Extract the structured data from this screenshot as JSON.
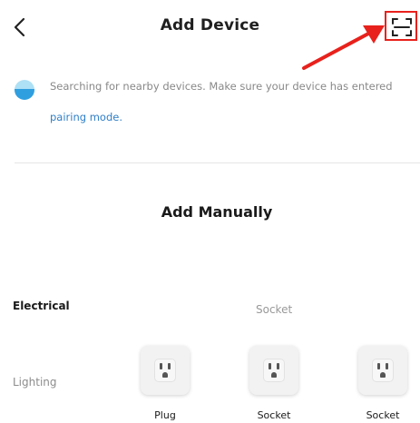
{
  "header": {
    "title": "Add Device",
    "back_icon": "chevron-left-icon",
    "scan_icon": "scan-frame-icon",
    "highlight_color": "#e8211c"
  },
  "search": {
    "message": "Searching for nearby devices. Make sure your device has entered",
    "link": "pairing mode.",
    "link_color": "#2f7fc8"
  },
  "manual": {
    "title": "Add Manually"
  },
  "sidebar": {
    "items": [
      {
        "label": "Electrical",
        "active": true
      },
      {
        "label": "Lighting",
        "active": false
      }
    ]
  },
  "category": {
    "header": "Socket",
    "devices": [
      {
        "label": "Plug",
        "icon": "outlet-icon"
      },
      {
        "label": "Socket",
        "icon": "outlet-icon"
      },
      {
        "label": "Socket",
        "icon": "outlet-icon"
      }
    ]
  }
}
